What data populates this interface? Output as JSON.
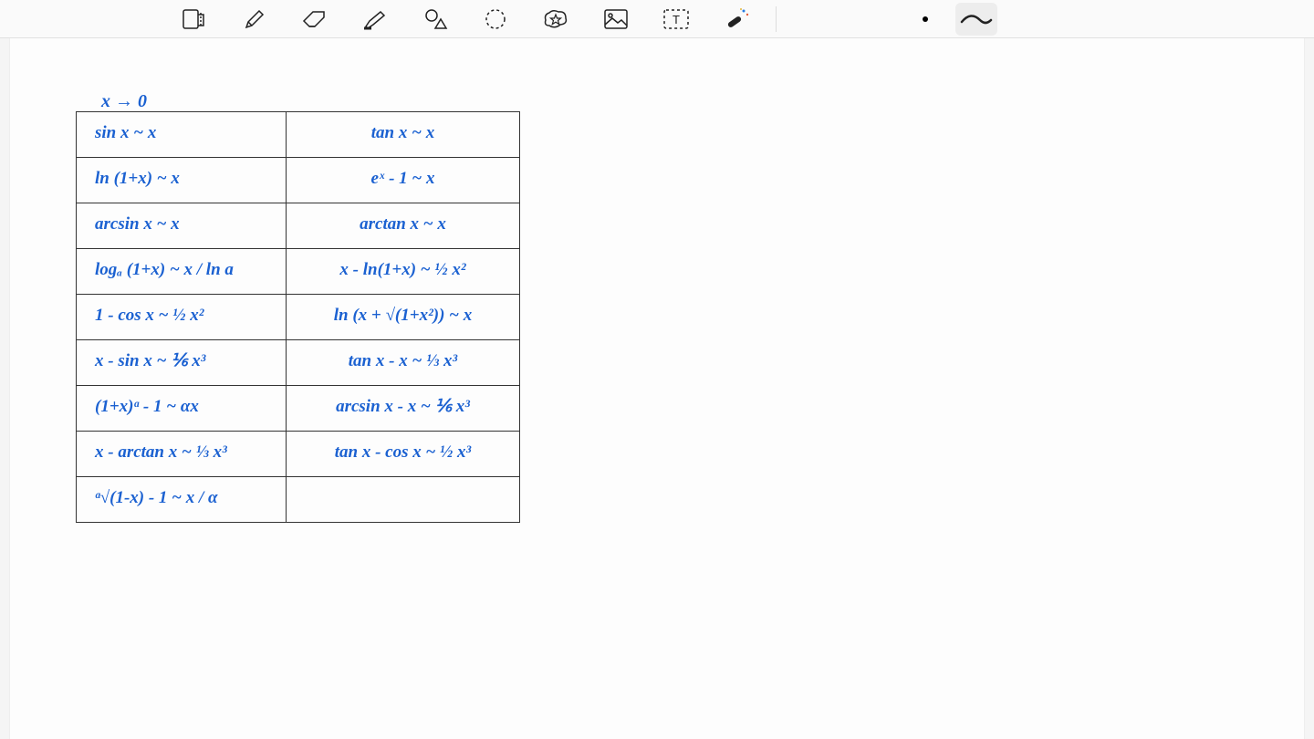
{
  "title_above_table": "x → 0",
  "table": {
    "rows": [
      {
        "left": "sin x ~ x",
        "right": "tan x ~ x"
      },
      {
        "left": "ln (1+x) ~ x",
        "right": "eˣ - 1 ~ x"
      },
      {
        "left": "arcsin x ~ x",
        "right": "arctan x ~ x"
      },
      {
        "left": "logₐ (1+x) ~ x / ln a",
        "right": "x - ln(1+x) ~ ½ x²"
      },
      {
        "left": "1 - cos x ~ ½ x²",
        "right": "ln (x + √(1+x²)) ~ x"
      },
      {
        "left": "x - sin x ~ ⅙ x³",
        "right": "tan x - x ~ ⅓ x³"
      },
      {
        "left": "(1+x)ᵅ - 1 ~ αx",
        "right": "arcsin x - x ~ ⅙ x³"
      },
      {
        "left": "x - arctan x ~ ⅓ x³",
        "right": "tan x - cos x ~ ½ x³"
      },
      {
        "left": "ᵅ√(1-x) - 1 ~ x / α",
        "right": ""
      }
    ]
  },
  "toolbar": {
    "tools": [
      "page-layout-icon",
      "pen-icon",
      "eraser-icon",
      "highlighter-icon",
      "shape-icon",
      "lasso-icon",
      "star-tool-icon",
      "image-icon",
      "text-icon",
      "magic-pen-icon"
    ],
    "active_color": "#000000",
    "stroke_style": "curve"
  }
}
